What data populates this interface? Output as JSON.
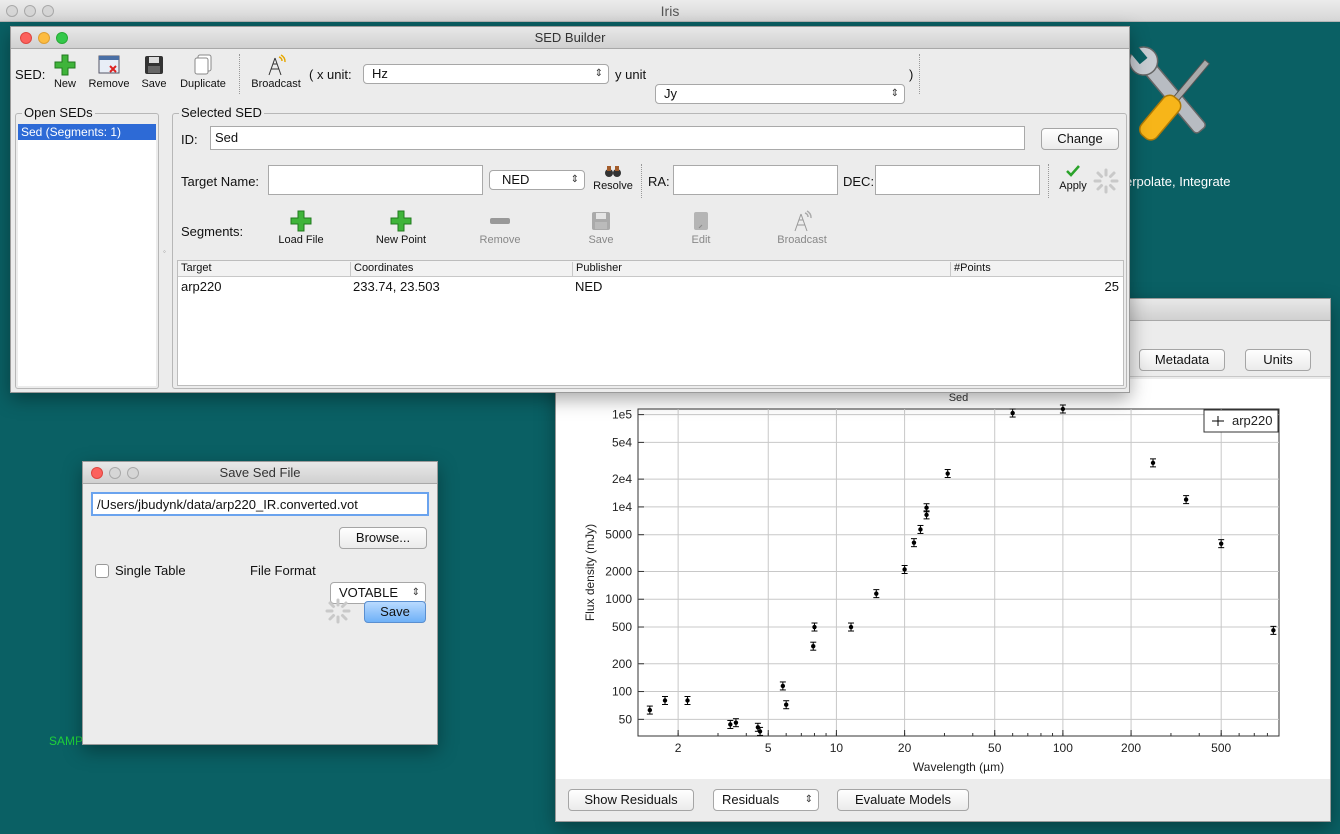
{
  "app": {
    "title": "Iris"
  },
  "tools_icon_label": "erpolate, Integrate",
  "samp_label": "SAMP",
  "sed_builder": {
    "title": "SED Builder",
    "toolbar": {
      "sed_label": "SED:",
      "new": "New",
      "remove": "Remove",
      "save": "Save",
      "duplicate": "Duplicate",
      "broadcast": "Broadcast",
      "x_unit_label": "( x unit:",
      "x_unit_value": "Hz",
      "y_unit_label": "y unit",
      "y_unit_value": "Jy",
      "close_paren": ")"
    },
    "open_seds": {
      "title": "Open SEDs",
      "items": [
        "Sed (Segments: 1)"
      ]
    },
    "selected": {
      "title": "Selected SED",
      "id_label": "ID:",
      "id_value": "Sed",
      "change": "Change",
      "target_name_label": "Target Name:",
      "target_name_value": "",
      "resolver": "NED",
      "resolve": "Resolve",
      "ra_label": "RA:",
      "ra_value": "",
      "dec_label": "DEC:",
      "dec_value": "",
      "apply": "Apply",
      "segments_label": "Segments:",
      "seg_buttons": {
        "load_file": "Load File",
        "new_point": "New Point",
        "remove": "Remove",
        "save": "Save",
        "edit": "Edit",
        "broadcast": "Broadcast"
      },
      "columns": [
        "Target",
        "Coordinates",
        "Publisher",
        "#Points"
      ],
      "rows": [
        {
          "target": "arp220",
          "coords": "233.74, 23.503",
          "publisher": "NED",
          "points": "25"
        }
      ]
    }
  },
  "save_dialog": {
    "title": "Save Sed File",
    "path": "/Users/jbudynk/data/arp220_IR.converted.vot",
    "browse": "Browse...",
    "single_table": "Single Table",
    "file_format_label": "File Format",
    "file_format_value": "VOTABLE",
    "save": "Save"
  },
  "viewer": {
    "metadata": "Metadata",
    "units": "Units",
    "show_residuals": "Show Residuals",
    "residuals_select": "Residuals",
    "evaluate_models": "Evaluate Models"
  },
  "chart_data": {
    "type": "scatter",
    "title": "Sed",
    "xlabel": "Wavelength (µm)",
    "ylabel": "Flux density (mJy)",
    "xscale": "log",
    "yscale": "log",
    "xlim": [
      1.33,
      900
    ],
    "ylim": [
      33,
      115000
    ],
    "xticks": [
      2,
      5,
      10,
      20,
      50,
      100,
      200,
      500
    ],
    "xtick_labels": [
      "2",
      "5",
      "10",
      "20",
      "50",
      "100",
      "200",
      "500"
    ],
    "yticks": [
      50,
      100,
      200,
      500,
      1000,
      2000,
      5000,
      10000,
      20000,
      50000,
      100000
    ],
    "ytick_labels": [
      "50",
      "100",
      "200",
      "500",
      "1000",
      "2000",
      "5000",
      "1e4",
      "2e4",
      "5e4",
      "1e5"
    ],
    "grid": true,
    "legend": {
      "position": "top-right",
      "entries": [
        "arp220"
      ]
    },
    "series": [
      {
        "name": "arp220",
        "marker": "dot-errorbar",
        "points": [
          {
            "x": 1.5,
            "y": 63
          },
          {
            "x": 1.75,
            "y": 80
          },
          {
            "x": 2.2,
            "y": 80
          },
          {
            "x": 3.4,
            "y": 44
          },
          {
            "x": 3.6,
            "y": 46
          },
          {
            "x": 4.5,
            "y": 41
          },
          {
            "x": 4.6,
            "y": 37
          },
          {
            "x": 5.8,
            "y": 115
          },
          {
            "x": 6.0,
            "y": 72
          },
          {
            "x": 7.9,
            "y": 310
          },
          {
            "x": 8.0,
            "y": 500
          },
          {
            "x": 11.6,
            "y": 500
          },
          {
            "x": 15.0,
            "y": 1150
          },
          {
            "x": 20.0,
            "y": 2100
          },
          {
            "x": 22.0,
            "y": 4100
          },
          {
            "x": 23.5,
            "y": 5700
          },
          {
            "x": 25.0,
            "y": 8200
          },
          {
            "x": 25.0,
            "y": 9800
          },
          {
            "x": 31.0,
            "y": 23000
          },
          {
            "x": 60.0,
            "y": 104000
          },
          {
            "x": 100.0,
            "y": 115000
          },
          {
            "x": 250.0,
            "y": 30000
          },
          {
            "x": 350.0,
            "y": 12000
          },
          {
            "x": 500.0,
            "y": 4000
          },
          {
            "x": 850.0,
            "y": 460
          }
        ]
      }
    ]
  }
}
